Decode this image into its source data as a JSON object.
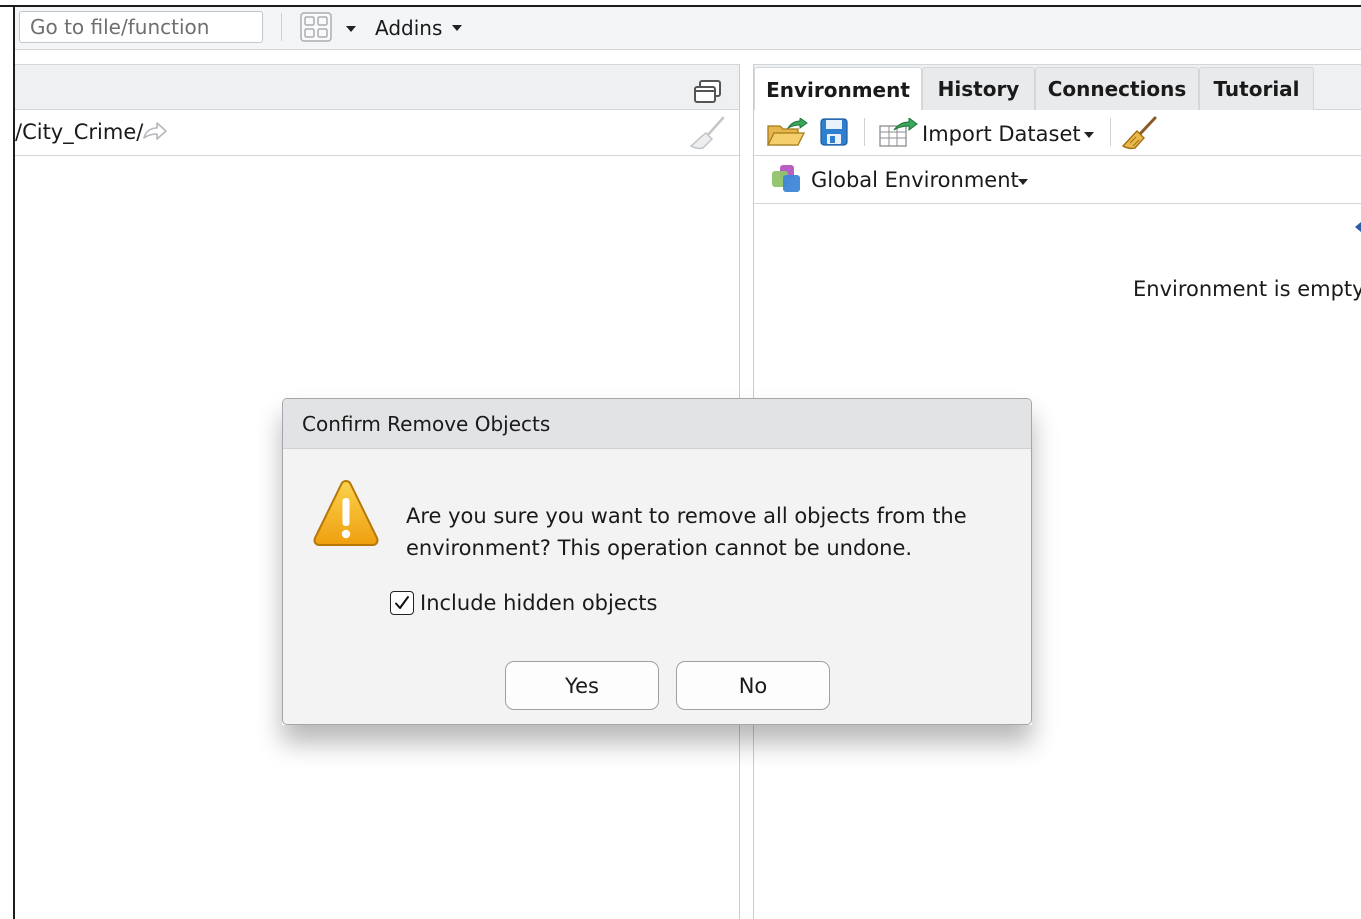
{
  "toolbar": {
    "goto_placeholder": "Go to file/function",
    "addins_label": "Addins",
    "grid_icon": "grid-icon"
  },
  "left_pane": {
    "path": "/City_Crime/"
  },
  "right_pane": {
    "tabs": [
      {
        "label": "Environment",
        "active": true
      },
      {
        "label": "History",
        "active": false
      },
      {
        "label": "Connections",
        "active": false
      },
      {
        "label": "Tutorial",
        "active": false
      }
    ],
    "import_label": "Import Dataset",
    "scope_label": "Global Environment",
    "empty_message": "Environment is empty"
  },
  "dialog": {
    "title": "Confirm Remove Objects",
    "message": "Are you sure you want to remove all objects from the environment? This operation cannot be undone.",
    "checkbox_label": "Include hidden objects",
    "checkbox_checked": true,
    "yes_label": "Yes",
    "no_label": "No"
  },
  "colors": {
    "warning": "#f2b418",
    "accent_green": "#3aa85a",
    "save_blue": "#2f7fd1"
  }
}
